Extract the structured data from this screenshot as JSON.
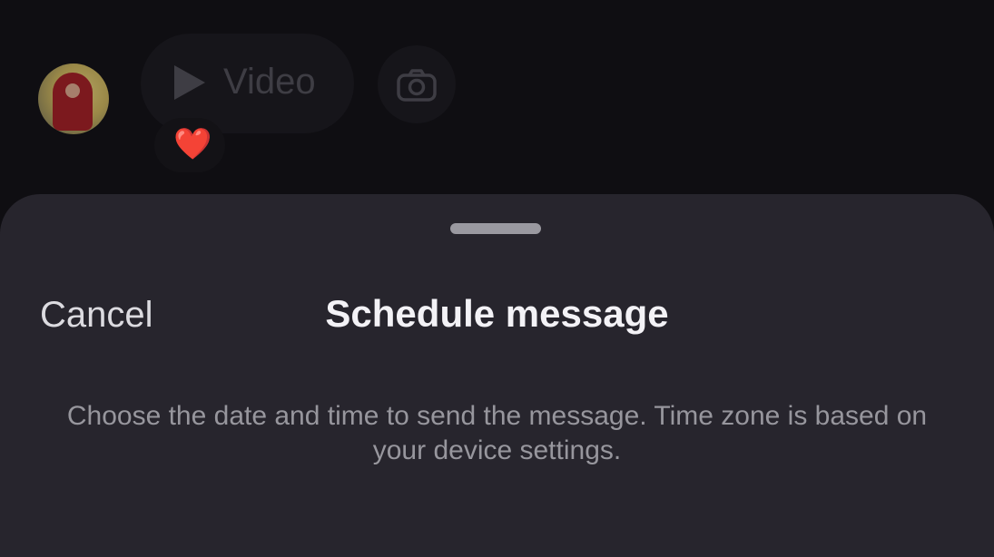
{
  "chat": {
    "video_label": "Video",
    "reaction_emoji": "❤️",
    "icons": {
      "play": "play-icon",
      "camera": "camera-icon"
    }
  },
  "sheet": {
    "cancel_label": "Cancel",
    "title": "Schedule message",
    "description": "Choose the date and time to send the message. Time zone is based on your device settings."
  },
  "colors": {
    "background": "#0f0e12",
    "sheet": "#27252d",
    "title_text": "#f3f2f6",
    "muted_text": "#97969d",
    "reaction_heart": "#8e2a30"
  }
}
